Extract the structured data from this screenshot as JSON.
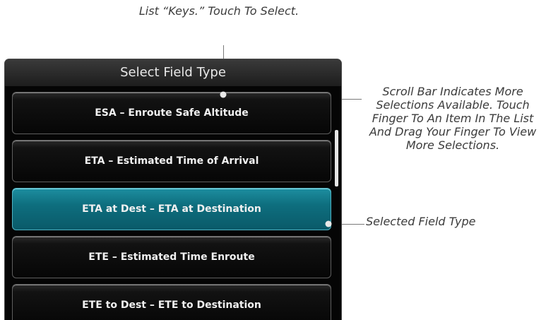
{
  "callouts": {
    "top": "List “Keys.” Touch To Select.",
    "scroll": "Scroll Bar Indicates More Selections Available. Touch Finger To An Item In The List And Drag Your Finger To View More Selections.",
    "selected": "Selected Field Type"
  },
  "panel": {
    "title": "Select Field Type",
    "items": [
      {
        "label": "ESA – Enroute Safe Altitude",
        "selected": false
      },
      {
        "label": "ETA – Estimated Time of Arrival",
        "selected": false
      },
      {
        "label": "ETA at Dest – ETA at Destination",
        "selected": true
      },
      {
        "label": "ETE – Estimated Time Enroute",
        "selected": false
      },
      {
        "label": "ETE to Dest – ETE to Destination",
        "selected": false
      }
    ]
  },
  "colors": {
    "selected_accent": "#0e6e7e",
    "panel_background": "#050505",
    "callout_text": "#3b3b3b"
  }
}
